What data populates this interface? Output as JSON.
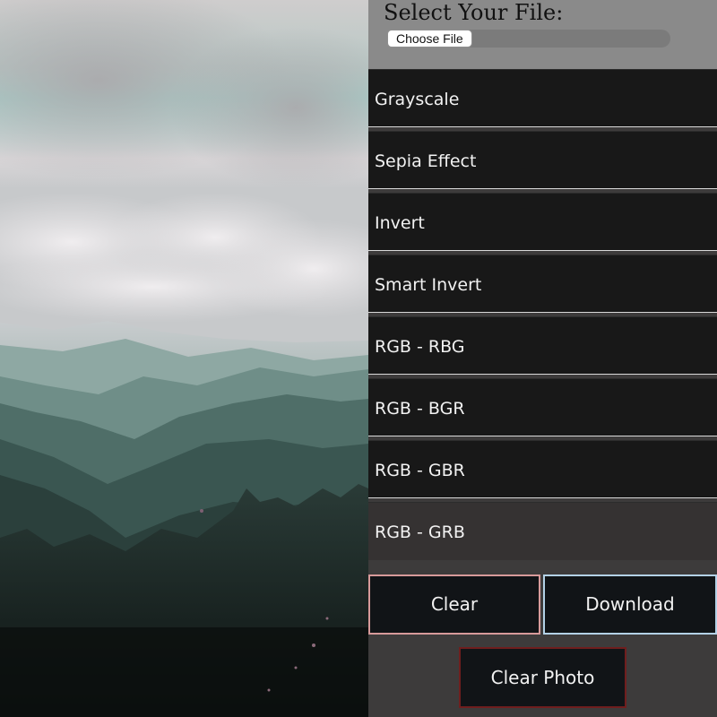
{
  "file_picker": {
    "title": "Select Your File:",
    "button_label": "Choose File",
    "status_text": ""
  },
  "filters": [
    {
      "label": "Grayscale",
      "name": "filter-grayscale-button",
      "active": false
    },
    {
      "label": "Sepia Effect",
      "name": "filter-sepia-button",
      "active": false
    },
    {
      "label": "Invert",
      "name": "filter-invert-button",
      "active": false
    },
    {
      "label": "Smart Invert",
      "name": "filter-smart-invert-button",
      "active": false
    },
    {
      "label": "RGB - RBG",
      "name": "filter-rgb-rbg-button",
      "active": false
    },
    {
      "label": "RGB - BGR",
      "name": "filter-rgb-bgr-button",
      "active": false
    },
    {
      "label": "RGB - GBR",
      "name": "filter-rgb-gbr-button",
      "active": false
    },
    {
      "label": "RGB - GRB",
      "name": "filter-rgb-grb-button",
      "active": true
    }
  ],
  "actions": {
    "clear_label": "Clear",
    "download_label": "Download",
    "clear_photo_label": "Clear Photo"
  },
  "colors": {
    "panel_bg": "#3d3b3b",
    "file_area_bg": "#8a8a8a",
    "filter_bg": "#181818",
    "filter_active_bg": "#353232",
    "clear_border": "#d79a9a",
    "download_border": "#b3d1e6",
    "clear_photo_border": "#6f1e1e"
  },
  "preview": {
    "subject": "misty mountain landscape photo"
  }
}
